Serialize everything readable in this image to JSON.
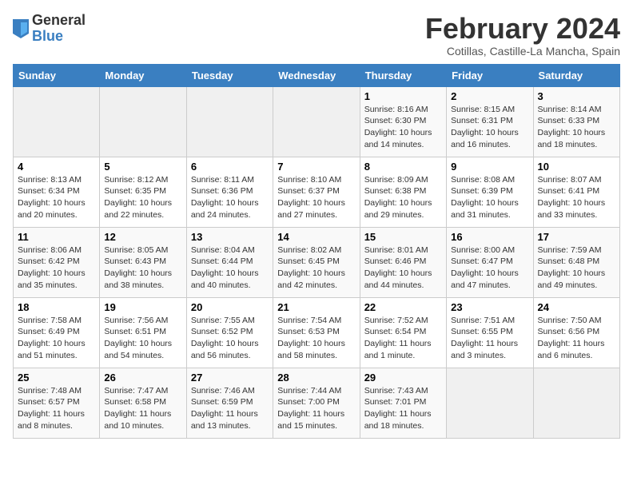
{
  "header": {
    "logo_general": "General",
    "logo_blue": "Blue",
    "title": "February 2024",
    "subtitle": "Cotillas, Castille-La Mancha, Spain"
  },
  "days_of_week": [
    "Sunday",
    "Monday",
    "Tuesday",
    "Wednesday",
    "Thursday",
    "Friday",
    "Saturday"
  ],
  "weeks": [
    [
      {
        "num": "",
        "info": ""
      },
      {
        "num": "",
        "info": ""
      },
      {
        "num": "",
        "info": ""
      },
      {
        "num": "",
        "info": ""
      },
      {
        "num": "1",
        "info": "Sunrise: 8:16 AM\nSunset: 6:30 PM\nDaylight: 10 hours and 14 minutes."
      },
      {
        "num": "2",
        "info": "Sunrise: 8:15 AM\nSunset: 6:31 PM\nDaylight: 10 hours and 16 minutes."
      },
      {
        "num": "3",
        "info": "Sunrise: 8:14 AM\nSunset: 6:33 PM\nDaylight: 10 hours and 18 minutes."
      }
    ],
    [
      {
        "num": "4",
        "info": "Sunrise: 8:13 AM\nSunset: 6:34 PM\nDaylight: 10 hours and 20 minutes."
      },
      {
        "num": "5",
        "info": "Sunrise: 8:12 AM\nSunset: 6:35 PM\nDaylight: 10 hours and 22 minutes."
      },
      {
        "num": "6",
        "info": "Sunrise: 8:11 AM\nSunset: 6:36 PM\nDaylight: 10 hours and 24 minutes."
      },
      {
        "num": "7",
        "info": "Sunrise: 8:10 AM\nSunset: 6:37 PM\nDaylight: 10 hours and 27 minutes."
      },
      {
        "num": "8",
        "info": "Sunrise: 8:09 AM\nSunset: 6:38 PM\nDaylight: 10 hours and 29 minutes."
      },
      {
        "num": "9",
        "info": "Sunrise: 8:08 AM\nSunset: 6:39 PM\nDaylight: 10 hours and 31 minutes."
      },
      {
        "num": "10",
        "info": "Sunrise: 8:07 AM\nSunset: 6:41 PM\nDaylight: 10 hours and 33 minutes."
      }
    ],
    [
      {
        "num": "11",
        "info": "Sunrise: 8:06 AM\nSunset: 6:42 PM\nDaylight: 10 hours and 35 minutes."
      },
      {
        "num": "12",
        "info": "Sunrise: 8:05 AM\nSunset: 6:43 PM\nDaylight: 10 hours and 38 minutes."
      },
      {
        "num": "13",
        "info": "Sunrise: 8:04 AM\nSunset: 6:44 PM\nDaylight: 10 hours and 40 minutes."
      },
      {
        "num": "14",
        "info": "Sunrise: 8:02 AM\nSunset: 6:45 PM\nDaylight: 10 hours and 42 minutes."
      },
      {
        "num": "15",
        "info": "Sunrise: 8:01 AM\nSunset: 6:46 PM\nDaylight: 10 hours and 44 minutes."
      },
      {
        "num": "16",
        "info": "Sunrise: 8:00 AM\nSunset: 6:47 PM\nDaylight: 10 hours and 47 minutes."
      },
      {
        "num": "17",
        "info": "Sunrise: 7:59 AM\nSunset: 6:48 PM\nDaylight: 10 hours and 49 minutes."
      }
    ],
    [
      {
        "num": "18",
        "info": "Sunrise: 7:58 AM\nSunset: 6:49 PM\nDaylight: 10 hours and 51 minutes."
      },
      {
        "num": "19",
        "info": "Sunrise: 7:56 AM\nSunset: 6:51 PM\nDaylight: 10 hours and 54 minutes."
      },
      {
        "num": "20",
        "info": "Sunrise: 7:55 AM\nSunset: 6:52 PM\nDaylight: 10 hours and 56 minutes."
      },
      {
        "num": "21",
        "info": "Sunrise: 7:54 AM\nSunset: 6:53 PM\nDaylight: 10 hours and 58 minutes."
      },
      {
        "num": "22",
        "info": "Sunrise: 7:52 AM\nSunset: 6:54 PM\nDaylight: 11 hours and 1 minute."
      },
      {
        "num": "23",
        "info": "Sunrise: 7:51 AM\nSunset: 6:55 PM\nDaylight: 11 hours and 3 minutes."
      },
      {
        "num": "24",
        "info": "Sunrise: 7:50 AM\nSunset: 6:56 PM\nDaylight: 11 hours and 6 minutes."
      }
    ],
    [
      {
        "num": "25",
        "info": "Sunrise: 7:48 AM\nSunset: 6:57 PM\nDaylight: 11 hours and 8 minutes."
      },
      {
        "num": "26",
        "info": "Sunrise: 7:47 AM\nSunset: 6:58 PM\nDaylight: 11 hours and 10 minutes."
      },
      {
        "num": "27",
        "info": "Sunrise: 7:46 AM\nSunset: 6:59 PM\nDaylight: 11 hours and 13 minutes."
      },
      {
        "num": "28",
        "info": "Sunrise: 7:44 AM\nSunset: 7:00 PM\nDaylight: 11 hours and 15 minutes."
      },
      {
        "num": "29",
        "info": "Sunrise: 7:43 AM\nSunset: 7:01 PM\nDaylight: 11 hours and 18 minutes."
      },
      {
        "num": "",
        "info": ""
      },
      {
        "num": "",
        "info": ""
      }
    ]
  ]
}
